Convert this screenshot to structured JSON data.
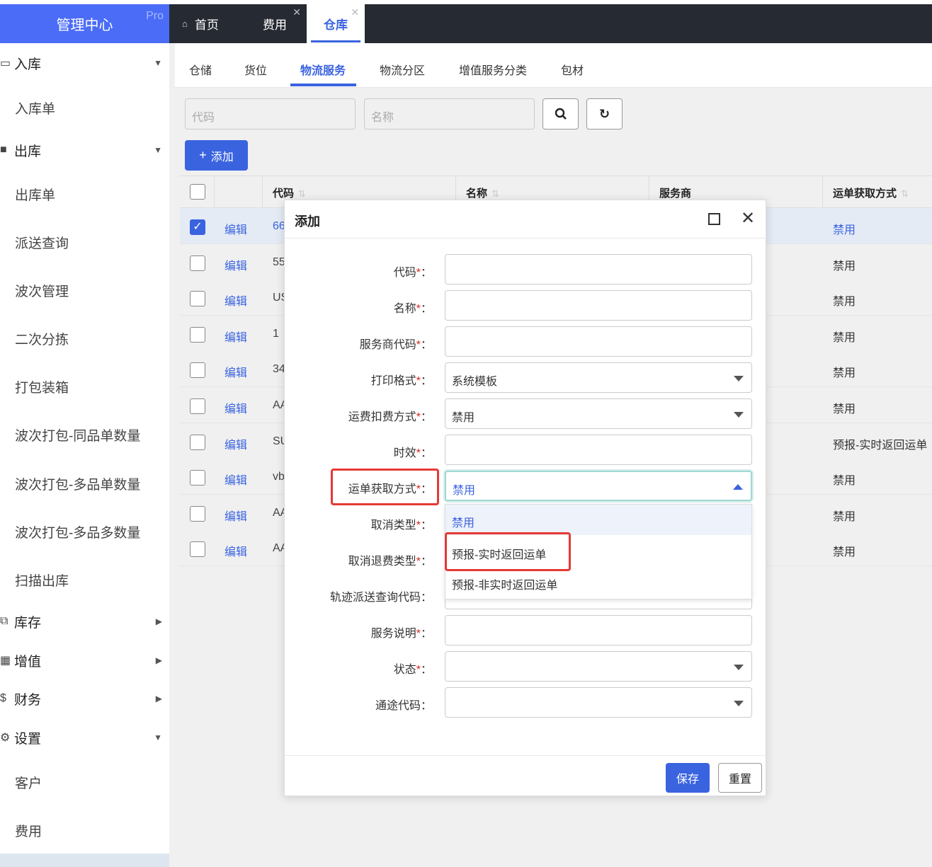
{
  "app": {
    "title": "管理中心",
    "badge": "Pro"
  },
  "sidebar": {
    "groups": [
      {
        "icon": "inbox-icon",
        "label": "入库",
        "expanded": true,
        "items": [
          "入库单"
        ]
      },
      {
        "icon": "truck-icon",
        "label": "出库",
        "expanded": true,
        "items": [
          "出库单",
          "派送查询",
          "波次管理",
          "二次分拣",
          "打包装箱",
          "波次打包-同品单数量",
          "波次打包-多品单数量",
          "波次打包-多品多数量",
          "扫描出库"
        ]
      },
      {
        "icon": "cubes-icon",
        "label": "库存",
        "expanded": false,
        "items": []
      },
      {
        "icon": "grid-icon",
        "label": "增值",
        "expanded": false,
        "items": []
      },
      {
        "icon": "dollar-icon",
        "label": "财务",
        "expanded": false,
        "items": []
      },
      {
        "icon": "gears-icon",
        "label": "设置",
        "expanded": true,
        "items": [
          "客户",
          "费用"
        ]
      }
    ]
  },
  "top_tabs": [
    {
      "label": "首页",
      "icon": "home-icon",
      "closable": false,
      "active": false
    },
    {
      "label": "费用",
      "closable": true,
      "active": false
    },
    {
      "label": "仓库",
      "closable": true,
      "active": true
    }
  ],
  "sub_tabs": [
    {
      "label": "仓储",
      "active": false
    },
    {
      "label": "货位",
      "active": false
    },
    {
      "label": "物流服务",
      "active": true
    },
    {
      "label": "物流分区",
      "active": false
    },
    {
      "label": "增值服务分类",
      "active": false
    },
    {
      "label": "包材",
      "active": false
    }
  ],
  "search": {
    "code_placeholder": "代码",
    "name_placeholder": "名称"
  },
  "toolbar": {
    "add_label": "添加"
  },
  "table": {
    "columns": [
      "代码",
      "名称",
      "服务商",
      "运单获取方式"
    ],
    "edit_label": "编辑",
    "rows": [
      {
        "code": "66",
        "way": "禁用",
        "selected": true
      },
      {
        "code": "55",
        "way": "禁用",
        "selected": false
      },
      {
        "code": "US",
        "way": "禁用",
        "selected": false
      },
      {
        "code": "1",
        "way": "禁用",
        "selected": false
      },
      {
        "code": "34",
        "way": "禁用",
        "selected": false
      },
      {
        "code": "AA",
        "way": "禁用",
        "selected": false
      },
      {
        "code": "SU",
        "way": "预报-实时返回运单",
        "selected": false
      },
      {
        "code": "vb",
        "way": "禁用",
        "selected": false
      },
      {
        "code": "AA",
        "way": "禁用",
        "selected": false
      },
      {
        "code": "AA",
        "way": "禁用",
        "selected": false
      }
    ]
  },
  "dialog": {
    "title": "添加",
    "fields": [
      {
        "label": "代码",
        "required": true,
        "type": "text",
        "value": ""
      },
      {
        "label": "名称",
        "required": true,
        "type": "text",
        "value": ""
      },
      {
        "label": "服务商代码",
        "required": true,
        "type": "text",
        "value": ""
      },
      {
        "label": "打印格式",
        "required": true,
        "type": "select",
        "value": "系统模板"
      },
      {
        "label": "运费扣费方式",
        "required": true,
        "type": "select",
        "value": "禁用"
      },
      {
        "label": "时效",
        "required": true,
        "type": "text",
        "value": ""
      },
      {
        "label": "运单获取方式",
        "required": true,
        "type": "select",
        "value": "禁用",
        "open": true
      },
      {
        "label": "取消类型",
        "required": true,
        "type": "select",
        "value": ""
      },
      {
        "label": "取消退费类型",
        "required": true,
        "type": "select",
        "value": ""
      },
      {
        "label": "轨迹派送查询代码",
        "required": false,
        "type": "text",
        "value": ""
      },
      {
        "label": "服务说明",
        "required": true,
        "type": "text",
        "value": ""
      },
      {
        "label": "状态",
        "required": true,
        "type": "select",
        "value": ""
      },
      {
        "label": "通途代码",
        "required": false,
        "type": "select",
        "value": ""
      }
    ],
    "dropdown_options": [
      "禁用",
      "预报-实时返回运单",
      "预报-非实时返回运单"
    ],
    "save_label": "保存",
    "reset_label": "重置"
  },
  "colors": {
    "primary": "#3a63e0",
    "logo_bg": "#4a6cf7",
    "topbar_bg": "#262a33",
    "required": "#e02020",
    "highlight_box": "#e53935"
  }
}
